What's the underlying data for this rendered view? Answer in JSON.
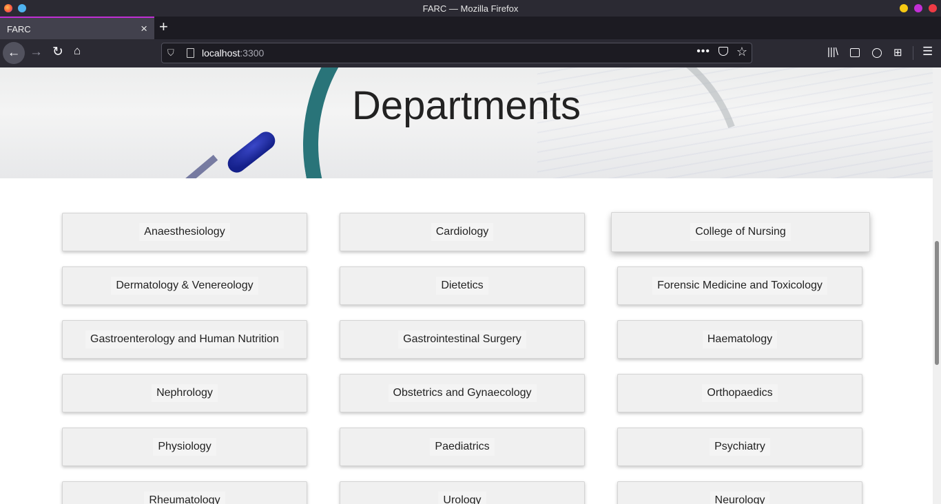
{
  "window": {
    "title": "FARC — Mozilla Firefox"
  },
  "tabs": [
    {
      "label": "FARC"
    }
  ],
  "navbar": {
    "url_host": "localhost",
    "url_port": ":3300"
  },
  "icons": {
    "close_tab": "×",
    "new_tab": "+",
    "back": "←",
    "forward": "→",
    "reload": "↻",
    "home": "⌂",
    "shield": "⛉",
    "more": "•••",
    "star": "☆",
    "library": "|||\\",
    "extensions": "⊞",
    "menu": "☰"
  },
  "page": {
    "heading": "Departments",
    "departments": [
      "Anaesthesiology",
      "Cardiology",
      "College of Nursing",
      "Dermatology & Venereology",
      "Dietetics",
      "Forensic Medicine and Toxicology",
      "Gastroenterology and Human Nutrition",
      "Gastrointestinal Surgery",
      "Haematology",
      "Nephrology",
      "Obstetrics and Gynaecology",
      "Orthopaedics",
      "Physiology",
      "Paediatrics",
      "Psychiatry",
      "Rheumatology",
      "Urology",
      "Neurology"
    ]
  },
  "colors": {
    "tab_accent": "#c22fd6",
    "chrome_bg": "#2b2a33",
    "button_bg": "#f0f0f0"
  }
}
